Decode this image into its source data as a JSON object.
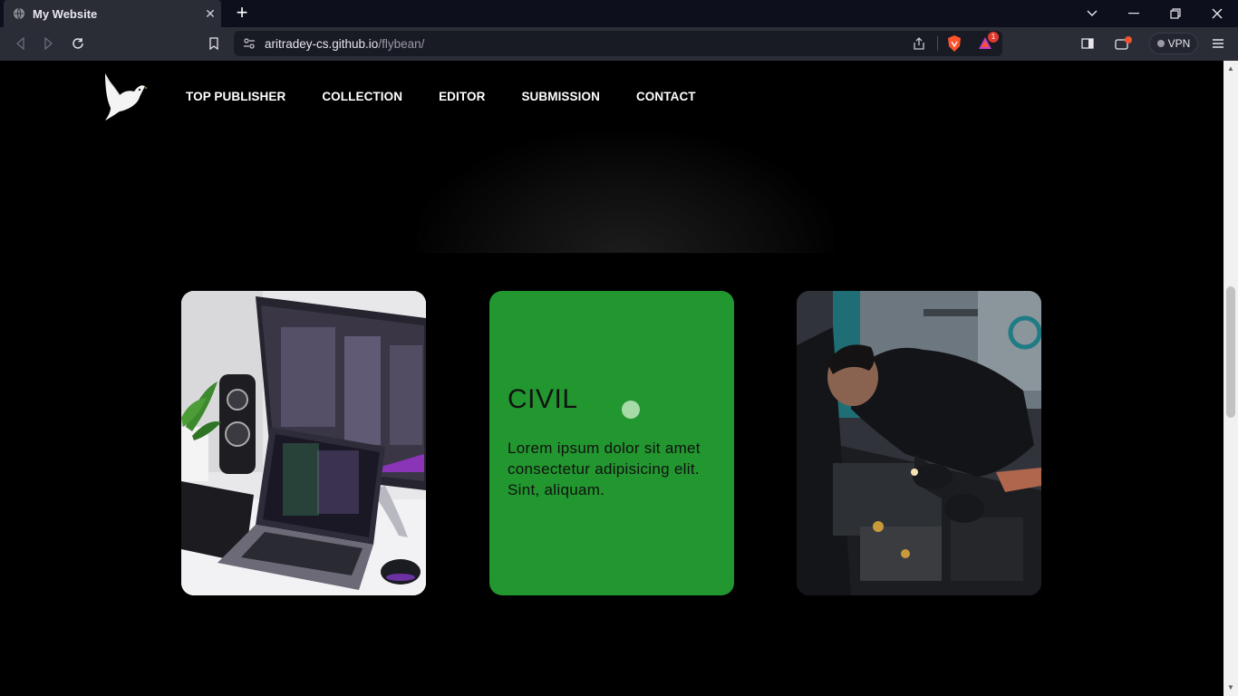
{
  "browser": {
    "tab_title": "My Website",
    "url_host": "aritradey-cs.github.io",
    "url_path": "/flybean/",
    "vpn_label": "VPN",
    "alert_count": "1"
  },
  "nav": {
    "items": [
      {
        "label": "TOP PUBLISHER"
      },
      {
        "label": "COLLECTION"
      },
      {
        "label": "EDITOR"
      },
      {
        "label": "SUBMISSION"
      },
      {
        "label": "CONTACT"
      }
    ]
  },
  "cards": {
    "laptop_image": "laptop-workstation-photo",
    "featured": {
      "title": "CIVIL",
      "text": "Lorem ipsum dolor sit amet consectetur adipisicing elit. Sint, aliquam.",
      "color": "#22962f"
    },
    "mechanic_image": "mechanic-engine-photo"
  }
}
